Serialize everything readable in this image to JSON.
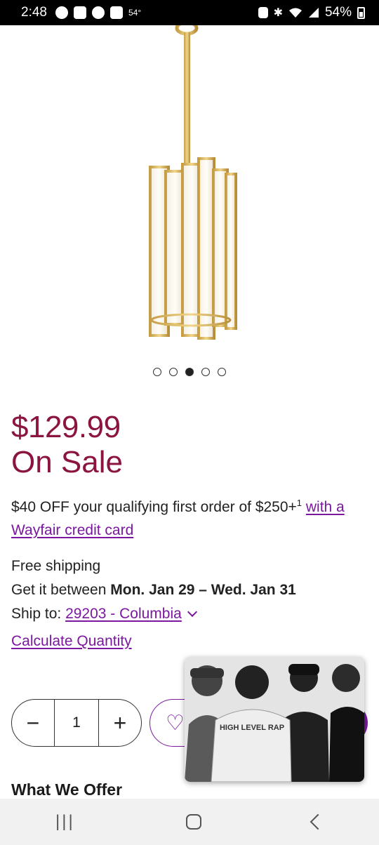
{
  "status_bar": {
    "time": "2:48",
    "temperature": "54°",
    "battery": "54%",
    "icons_left": [
      "messenger-icon",
      "app-icon",
      "chrome-icon",
      "gallery-icon"
    ],
    "icons_right": [
      "alarm-icon",
      "bluetooth-icon",
      "wifi-icon",
      "signal-icon",
      "battery-icon"
    ]
  },
  "product": {
    "carousel": {
      "total": 5,
      "active_index": 2
    },
    "price": "$129.99",
    "sale_label": "On Sale",
    "promo_text": "$40 OFF your qualifying first order of $250+",
    "promo_sup": "1",
    "promo_link": "with a Wayfair credit card",
    "free_shipping": "Free shipping",
    "delivery_prefix": "Get it between",
    "delivery_range": "Mon. Jan 29 – Wed. Jan 31",
    "ship_to_label": "Ship to:",
    "ship_to_value": "29203 - Columbia",
    "calculate_quantity": "Calculate Quantity",
    "quantity": "1",
    "section_title": "What We Offer"
  },
  "video_overlay": {
    "caption_shirt": "HIGH LEVEL RAP"
  },
  "colors": {
    "brand_price": "#8b1540",
    "link": "#7b189f"
  },
  "nav_bar": {
    "buttons": [
      "recent-apps",
      "home",
      "back"
    ]
  }
}
